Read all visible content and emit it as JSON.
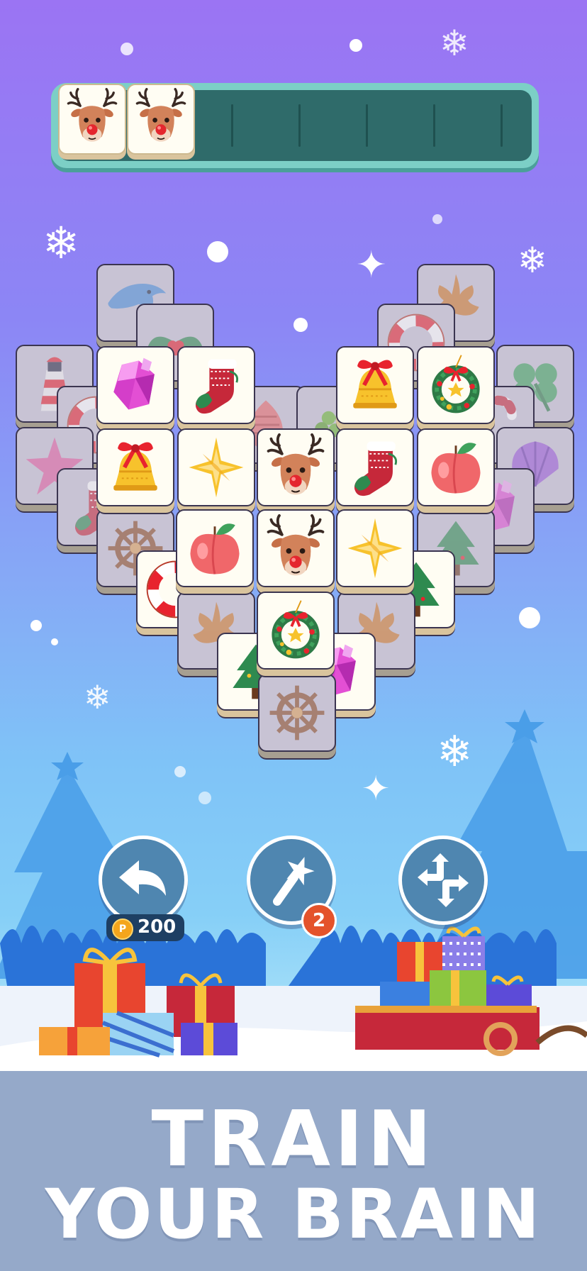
{
  "tray": {
    "slots_total": 7,
    "tiles": [
      {
        "icon": "reindeer-icon"
      },
      {
        "icon": "reindeer-icon"
      }
    ]
  },
  "board": {
    "top_tiles": [
      {
        "icon": "crystal-icon"
      },
      {
        "icon": "stocking-icon"
      },
      {
        "icon": "bell-icon"
      },
      {
        "icon": "wreath-icon"
      },
      {
        "icon": "bell-icon"
      },
      {
        "icon": "star-icon"
      },
      {
        "icon": "reindeer-icon"
      },
      {
        "icon": "stocking-icon"
      },
      {
        "icon": "peach-icon"
      },
      {
        "icon": "peach-icon"
      },
      {
        "icon": "reindeer-icon"
      },
      {
        "icon": "star-icon"
      },
      {
        "icon": "wreath-icon"
      }
    ],
    "lower_tiles": [
      "dolphin-icon",
      "holly-icon",
      "leaf-icon",
      "lifebuoy-icon",
      "lighthouse-icon",
      "clover-icon",
      "seashell-icon",
      "grapes-icon",
      "candy-cane-icon",
      "starfish-icon",
      "shell-icon",
      "crystal-icon",
      "christmas-tree-icon",
      "ship-wheel-icon"
    ]
  },
  "controls": {
    "undo": {
      "icon": "undo-arrow-icon",
      "cost": "200"
    },
    "magic_wand": {
      "icon": "magic-wand-icon",
      "count": "2"
    },
    "shuffle": {
      "icon": "shuffle-icon"
    }
  },
  "colors": {
    "sky_top": "#9b74f3",
    "sky_bottom": "#86cff7",
    "banner": "#95a9c9",
    "tray": "#2f6b6a"
  },
  "headline": {
    "line1": "TRAIN",
    "line2": "YOUR BRAIN"
  }
}
